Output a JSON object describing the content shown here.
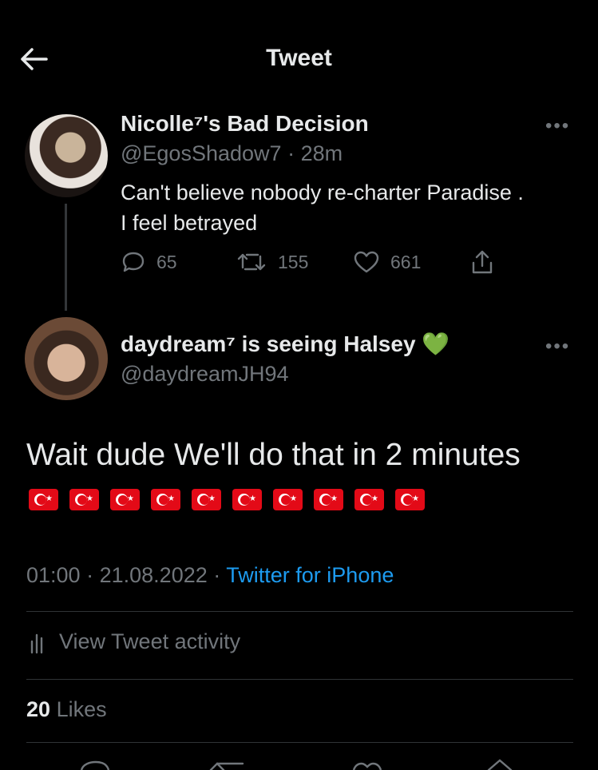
{
  "header": {
    "title": "Tweet",
    "back_icon": "arrow-left-icon"
  },
  "parent_tweet": {
    "display_name": "Nicolle⁷'s Bad Decision",
    "handle": "@EgosShadow7",
    "separator": "·",
    "time": "28m",
    "text_line1": "Can't believe nobody re-charter Paradise .",
    "text_line2": "I feel betrayed",
    "more_icon": "•••",
    "replies": "65",
    "retweets": "155",
    "likes": "661"
  },
  "main_tweet": {
    "display_name": "daydream⁷ is seeing Halsey 💚",
    "handle": "@daydreamJH94",
    "more_icon": "•••",
    "text": "Wait dude We'll do that in 2 minutes",
    "flag_count": 10,
    "time": "01:00",
    "date": "21.08.2022",
    "separator": "·",
    "source": "Twitter for iPhone"
  },
  "activity": {
    "label": "View Tweet activity"
  },
  "likes_row": {
    "count": "20",
    "label": "Likes"
  },
  "colors": {
    "background": "#000000",
    "text": "#e7e9ea",
    "muted": "#71767b",
    "link": "#1d9bf0",
    "flag_red": "#e30a17"
  }
}
